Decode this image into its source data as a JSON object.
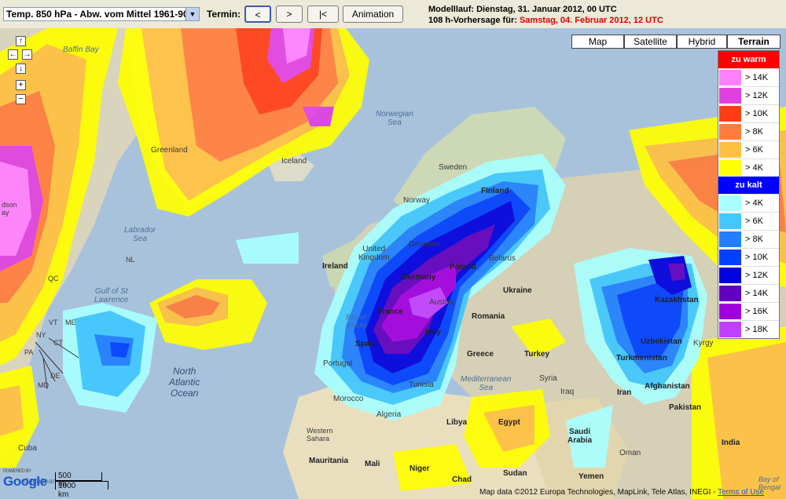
{
  "toolbar": {
    "parameter": "Temp. 850 hPa - Abw. vom Mittel 1961-90",
    "termin_label": "Termin:",
    "buttons": [
      {
        "name": "prev-button",
        "label": "<"
      },
      {
        "name": "next-button",
        "label": ">"
      },
      {
        "name": "first-button",
        "label": "|<"
      },
      {
        "name": "animation-button",
        "label": "Animation"
      }
    ],
    "run_line1": "Modelllauf: Dienstag, 31. Januar 2012, 00 UTC",
    "run_line2_prefix": "108 h-Vorhersage für:",
    "run_line2_date": "Samstag, 04. Februar 2012, 12 UTC"
  },
  "map_types": [
    {
      "name": "map",
      "label": "Map",
      "active": false
    },
    {
      "name": "satellite",
      "label": "Satellite",
      "active": false
    },
    {
      "name": "hybrid",
      "label": "Hybrid",
      "active": false
    },
    {
      "name": "terrain",
      "label": "Terrain",
      "active": true
    }
  ],
  "nav": {
    "up": "↑",
    "left": "←",
    "right": "→",
    "down": "↓",
    "zoom_in": "+",
    "zoom_out": "−"
  },
  "legend": {
    "warm_header": "zu warm",
    "cold_header": "zu kalt",
    "warm_header_color": "#ff0000",
    "cold_header_color": "#0000ff",
    "warm": [
      {
        "label": "> 14K",
        "color": "#ff80ff"
      },
      {
        "label": "> 12K",
        "color": "#e040e0"
      },
      {
        "label": "> 10K",
        "color": "#ff3c14"
      },
      {
        "label": "> 8K",
        "color": "#ff7c3c"
      },
      {
        "label": "> 6K",
        "color": "#ffc040"
      },
      {
        "label": "> 4K",
        "color": "#ffff00"
      }
    ],
    "cold": [
      {
        "label": "> 4K",
        "color": "#a8ffff"
      },
      {
        "label": "> 6K",
        "color": "#40c8ff"
      },
      {
        "label": "> 8K",
        "color": "#2080ff"
      },
      {
        "label": "> 10K",
        "color": "#0040ff"
      },
      {
        "label": "> 12K",
        "color": "#0000e0"
      },
      {
        "label": "> 14K",
        "color": "#6000c0"
      },
      {
        "label": "> 16K",
        "color": "#a000e0"
      },
      {
        "label": "> 18K",
        "color": "#c040ff"
      }
    ]
  },
  "labels": {
    "baffin_bay": "Baffin Bay",
    "greenland": "Greenland",
    "iceland": "Iceland",
    "norwegian_sea": "Norwegian\nSea",
    "sweden": "Sweden",
    "finland": "Finland",
    "norway": "Norway",
    "labrador_sea": "Labrador\nSea",
    "ireland": "Ireland",
    "united_kingdom": "United\nKingdom",
    "denmark": "Denmark",
    "belarus": "Belarus",
    "germany": "Germany",
    "poland": "Poland",
    "ukraine": "Ukraine",
    "kazakhstan": "Kazakhstan",
    "france": "France",
    "austria": "Austria",
    "bay_of_biscay": "Bay of\nBiscay",
    "romania": "Romania",
    "spain": "Spain",
    "italy": "Italy",
    "greece": "Greece",
    "turkey": "Turkey",
    "uzbekistan": "Uzbekistan",
    "kyrgyzstan": "Kyrgy",
    "turkmenistan": "Turkmenistan",
    "portugal": "Portugal",
    "tunisia": "Tunisia",
    "mediterranean": "Mediterranean\nSea",
    "syria": "Syria",
    "iraq": "Iraq",
    "iran": "Iran",
    "afghanistan": "Afghanistan",
    "pakistan": "Pakistan",
    "morocco": "Morocco",
    "algeria": "Algeria",
    "libya": "Libya",
    "egypt": "Egypt",
    "saudi": "Saudi\nArabia",
    "oman": "Oman",
    "india": "India",
    "western_sahara": "Western\nSahara",
    "mauritania": "Mauritania",
    "mali": "Mali",
    "niger": "Niger",
    "chad": "Chad",
    "sudan": "Sudan",
    "yemen": "Yemen",
    "cuba": "Cuba",
    "caribbean": "Caribbean",
    "gulf_st_lawrence": "Gulf of St\nLawrence",
    "qc": "QC",
    "nl": "NL",
    "me": "ME",
    "vt": "VT",
    "ny": "NY",
    "ct": "CT",
    "md": "MD",
    "de": "DE",
    "pa": "PA",
    "north_atlantic": "North\nAtlantic\nOcean",
    "bay_of_bengal": "Bay of\nBengal",
    "hudson": "dson\nay"
  },
  "scale": {
    "miles": "500 mi",
    "km": "1000 km"
  },
  "google": {
    "powered": "POWERED BY",
    "logo": "Google"
  },
  "attribution": {
    "text": "Map data ©2012 Europa Technologies, MapLink, Tele Atlas, INEGI -",
    "terms": "Terms of Use"
  }
}
